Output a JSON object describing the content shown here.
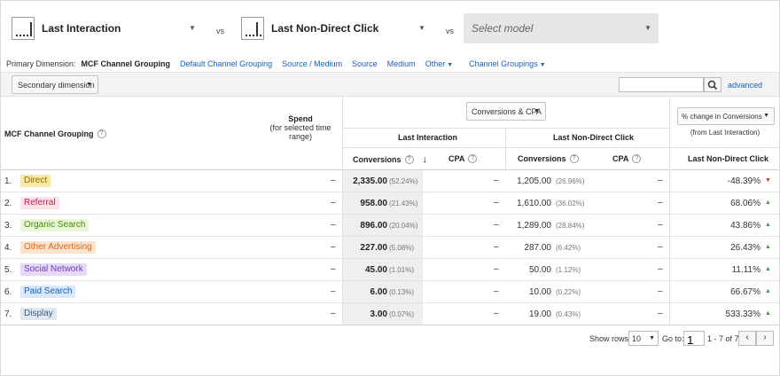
{
  "models": {
    "first": {
      "label": "Last Interaction"
    },
    "second": {
      "label": "Last Non-Direct Click"
    },
    "vs": "vs",
    "third_placeholder": "Select model"
  },
  "primary_dimension": {
    "label": "Primary Dimension:",
    "current": "MCF Channel Grouping",
    "links": [
      "Default Channel Grouping",
      "Source / Medium",
      "Source",
      "Medium",
      "Other",
      "Channel Groupings"
    ]
  },
  "toolbar": {
    "secondary_dimension": "Secondary dimension",
    "search_value": "",
    "advanced": "advanced"
  },
  "headers": {
    "mcf": "MCF Channel Grouping",
    "spend_title": "Spend",
    "spend_sub": "(for selected time range)",
    "metric_selector": "Conversions & CPA",
    "last_interaction": "Last Interaction",
    "last_non_direct": "Last Non-Direct Click",
    "conversions": "Conversions",
    "cpa": "CPA",
    "pct_selector": "% change in Conversions",
    "from_last": "(from Last Interaction)",
    "pct_col": "Last Non-Direct Click"
  },
  "rows": [
    {
      "num": "1.",
      "channel": "Direct",
      "bg": "#fce8a6",
      "fg": "#8a6d00",
      "spend": "–",
      "li_conv": "2,335.00",
      "li_pct": "(52.24%)",
      "li_cpa": "–",
      "lnd_conv": "1,205.00",
      "lnd_pct": "(26.96%)",
      "lnd_cpa": "–",
      "change": "-48.39%",
      "dir": "down"
    },
    {
      "num": "2.",
      "channel": "Referral",
      "bg": "#fde3e6",
      "fg": "#c2185b",
      "spend": "–",
      "li_conv": "958.00",
      "li_pct": "(21.43%)",
      "li_cpa": "–",
      "lnd_conv": "1,610.00",
      "lnd_pct": "(36.02%)",
      "lnd_cpa": "–",
      "change": "68.06%",
      "dir": "up"
    },
    {
      "num": "3.",
      "channel": "Organic Search",
      "bg": "#eaf6d8",
      "fg": "#4a8a12",
      "spend": "–",
      "li_conv": "896.00",
      "li_pct": "(20.04%)",
      "li_cpa": "–",
      "lnd_conv": "1,289.00",
      "lnd_pct": "(28.84%)",
      "lnd_cpa": "–",
      "change": "43.86%",
      "dir": "up"
    },
    {
      "num": "4.",
      "channel": "Other Advertising",
      "bg": "#fde3cc",
      "fg": "#d2691e",
      "spend": "–",
      "li_conv": "227.00",
      "li_pct": "(5.08%)",
      "li_cpa": "–",
      "lnd_conv": "287.00",
      "lnd_pct": "(6.42%)",
      "lnd_cpa": "–",
      "change": "26.43%",
      "dir": "up"
    },
    {
      "num": "5.",
      "channel": "Social Network",
      "bg": "#e5d9f7",
      "fg": "#6a3fb5",
      "spend": "–",
      "li_conv": "45.00",
      "li_pct": "(1.01%)",
      "li_cpa": "–",
      "lnd_conv": "50.00",
      "lnd_pct": "(1.12%)",
      "lnd_cpa": "–",
      "change": "11.11%",
      "dir": "up"
    },
    {
      "num": "6.",
      "channel": "Paid Search",
      "bg": "#d9e8fb",
      "fg": "#1a5fb4",
      "spend": "–",
      "li_conv": "6.00",
      "li_pct": "(0.13%)",
      "li_cpa": "–",
      "lnd_conv": "10.00",
      "lnd_pct": "(0.22%)",
      "lnd_cpa": "–",
      "change": "66.67%",
      "dir": "up"
    },
    {
      "num": "7.",
      "channel": "Display",
      "bg": "#e1e8f0",
      "fg": "#3b5a80",
      "spend": "–",
      "li_conv": "3.00",
      "li_pct": "(0.07%)",
      "li_cpa": "–",
      "lnd_conv": "19.00",
      "lnd_pct": "(0.43%)",
      "lnd_cpa": "–",
      "change": "533.33%",
      "dir": "up"
    }
  ],
  "footer": {
    "show_rows_label": "Show rows:",
    "show_rows_value": "10",
    "goto_label": "Go to:",
    "goto_value": "1",
    "range": "1 - 7 of 7"
  },
  "colors": {
    "link": "#1a5fb4",
    "up": "#2e9e3e",
    "down": "#d93025"
  }
}
